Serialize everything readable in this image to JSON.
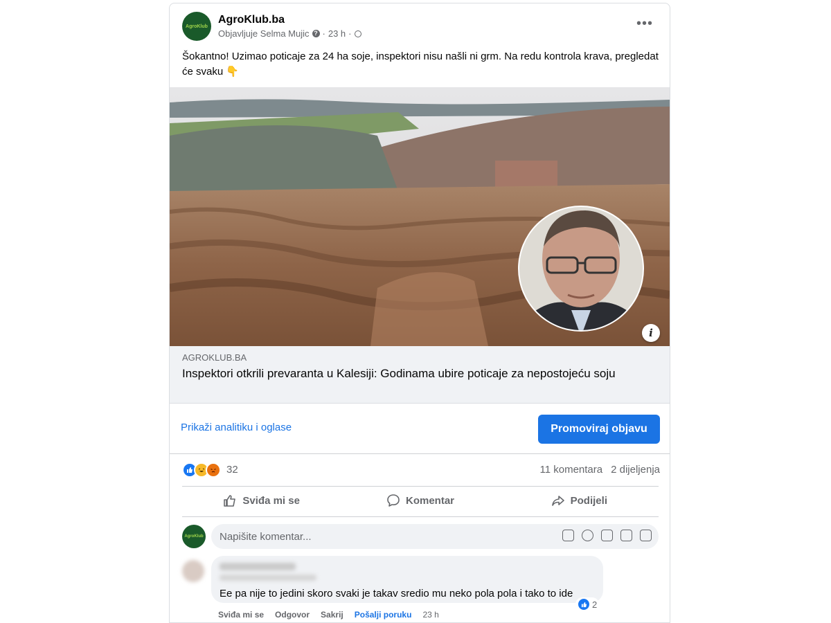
{
  "post": {
    "page_name": "AgroKlub.ba",
    "logo_text": "AgroKlub",
    "published_by": "Objavljuje Selma Mujic",
    "time": "23 h",
    "text": "Šokantno! Uzimao poticaje za 24 ha soje, inspektori nisu našli ni grm. Na redu kontrola krava, pregledat će svaku 👇",
    "more_icon": "more-horizontal-icon"
  },
  "link": {
    "domain": "AGROKLUB.BA",
    "title": "Inspektori otkrili prevaranta u Kalesiji: Godinama ubire poticaje za nepostojeću soju",
    "info_label": "i"
  },
  "promo": {
    "insights_link": "Prikaži analitiku i oglase",
    "boost_button": "Promoviraj objavu",
    "accent": "#1b74e4"
  },
  "engagement": {
    "reactions_count": "32",
    "reactions": [
      "like",
      "haha",
      "angry"
    ],
    "comments": "11 komentara",
    "shares": "2 dijeljenja"
  },
  "actions": {
    "like": "Sviđa mi se",
    "comment": "Komentar",
    "share": "Podijeli"
  },
  "composer": {
    "placeholder": "Napišite komentar..."
  },
  "comment": {
    "text": "Ee pa nije to jedini skoro svaki je takav sredio mu neko pola pola i tako to ide",
    "likes": "2",
    "like": "Sviđa mi se",
    "reply": "Odgovor",
    "hide": "Sakrij",
    "message": "Pošalji poruku",
    "time": "23 h"
  }
}
